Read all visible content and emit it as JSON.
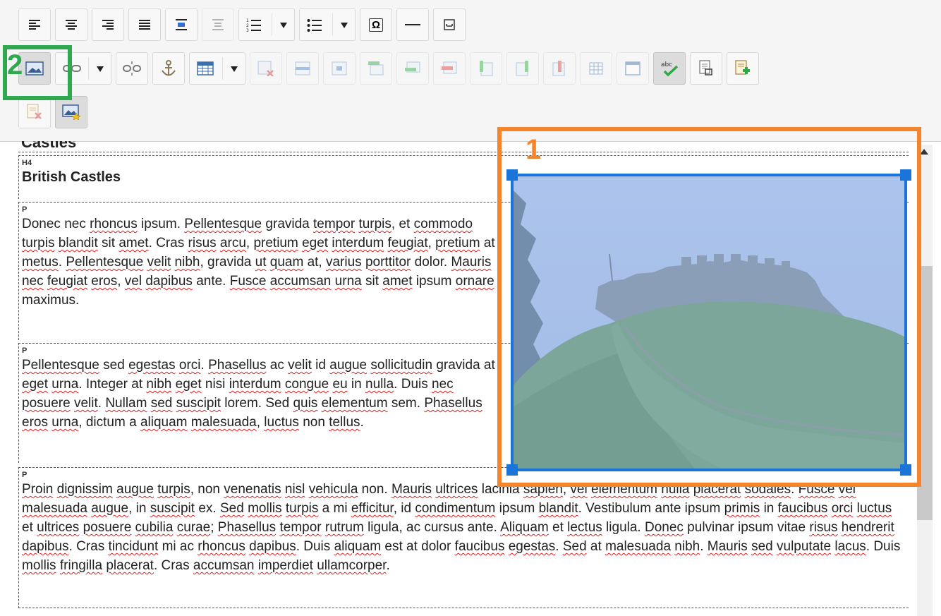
{
  "toolbar": {
    "row1": [
      {
        "icon": "align-left-icon"
      },
      {
        "icon": "align-center-icon"
      },
      {
        "icon": "align-right-icon"
      },
      {
        "icon": "align-justify-icon"
      },
      {
        "icon": "indent-icon"
      },
      {
        "icon": "outdent-icon"
      },
      {
        "icon": "numbered-list-icon"
      },
      {
        "icon": "bulleted-list-icon"
      },
      {
        "icon": "special-char-icon",
        "glyph": "Ω"
      },
      {
        "icon": "horizontal-rule-icon"
      },
      {
        "icon": "page-break-icon"
      }
    ],
    "row2_tooltips": {
      "image": "Image",
      "spellcheck": "abc"
    },
    "spellcheck_label": "abc"
  },
  "document": {
    "cut_heading": "Castles",
    "h4": {
      "tag": "H4",
      "text": "British Castles"
    },
    "paragraphs": [
      {
        "tag": "P"
      },
      {
        "tag": "P"
      },
      {
        "tag": "P"
      }
    ]
  },
  "annotations": {
    "box1_number": "1",
    "box2_number": "2",
    "box1_color": "#f5852a",
    "box2_color": "#2fa84f",
    "selection_color": "#1b75d8"
  },
  "image": {
    "subject": "castle-on-hill-image"
  }
}
